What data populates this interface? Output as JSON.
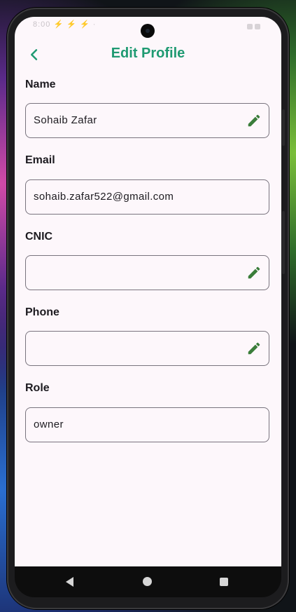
{
  "app": {
    "title": "Edit Profile",
    "accent_color": "#1f9a72",
    "edit_icon_color": "#3a7d3a"
  },
  "status_bar": {
    "left_text": "8:00 ⚡ ⚡ ⚡ ·"
  },
  "fields": [
    {
      "label": "Name",
      "value": "Sohaib Zafar",
      "editable": true
    },
    {
      "label": "Email",
      "value": "sohaib.zafar522@gmail.com",
      "editable": false
    },
    {
      "label": "CNIC",
      "value": "",
      "editable": true
    },
    {
      "label": "Phone",
      "value": "",
      "editable": true
    },
    {
      "label": "Role",
      "value": "owner",
      "editable": false
    }
  ],
  "icons": {
    "back": "chevron-left-icon",
    "edit": "pencil-icon",
    "nav_back": "triangle-back-icon",
    "nav_home": "circle-home-icon",
    "nav_recent": "square-recent-icon"
  }
}
